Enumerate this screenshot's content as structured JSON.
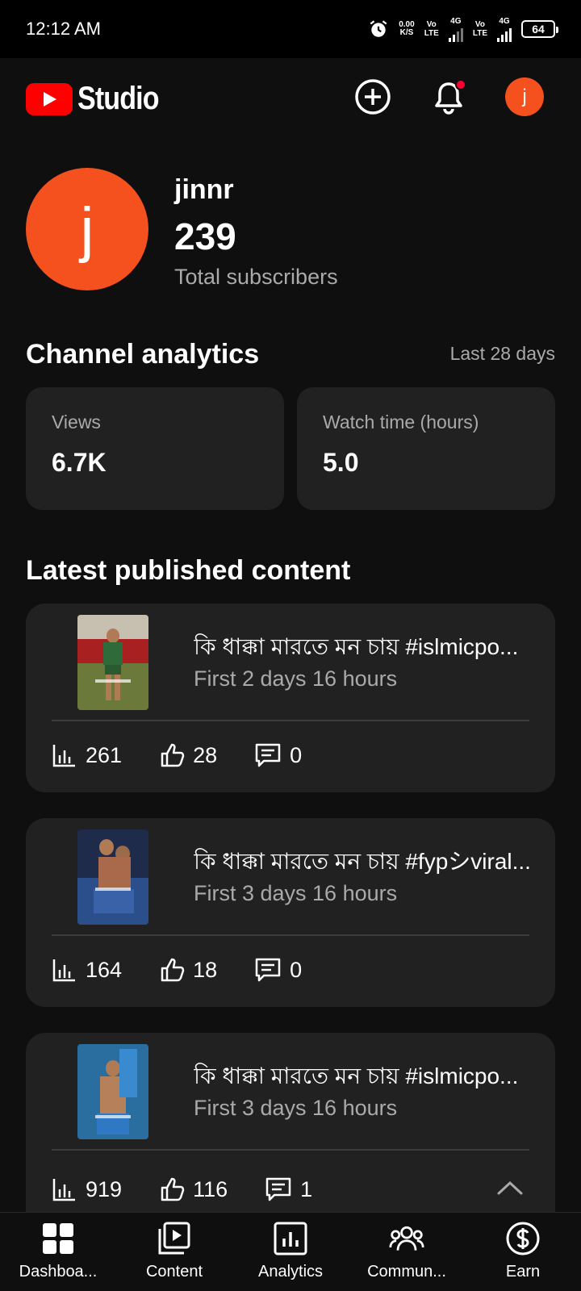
{
  "status_bar": {
    "time": "12:12 AM",
    "net_speed_value": "0.00",
    "net_speed_unit": "K/S",
    "sim1_top": "Vo",
    "sim1_bottom": "LTE",
    "sim1_type": "4G",
    "sim2_top": "Vo",
    "sim2_bottom": "LTE",
    "sim2_type": "4G",
    "battery": "64"
  },
  "header": {
    "logo_text": "Studio",
    "avatar_letter": "j",
    "icons": [
      "create-icon",
      "bell-icon"
    ]
  },
  "channel": {
    "avatar_letter": "j",
    "name": "jinnr",
    "subscriber_count": "239",
    "subscriber_label": "Total subscribers"
  },
  "analytics": {
    "title": "Channel analytics",
    "period": "Last 28 days",
    "cards": [
      {
        "label": "Views",
        "value": "6.7K"
      },
      {
        "label": "Watch time (hours)",
        "value": "5.0"
      }
    ]
  },
  "latest": {
    "title": "Latest published content",
    "videos": [
      {
        "title": "কি ধাক্কা মারতে মন চায় #islmicpo...",
        "age": "First 2 days 16 hours",
        "views": "261",
        "likes": "28",
        "comments": "0"
      },
      {
        "title": "কি ধাক্কা মারতে মন চায় #fypシviral...",
        "age": "First 3 days 16 hours",
        "views": "164",
        "likes": "18",
        "comments": "0"
      },
      {
        "title": "কি ধাক্কা মারতে মন চায় #islmicpo...",
        "age": "First 3 days 16 hours",
        "views": "919",
        "likes": "116",
        "comments": "1"
      }
    ]
  },
  "nav": {
    "items": [
      {
        "label": "Dashboa...",
        "icon": "dashboard-icon"
      },
      {
        "label": "Content",
        "icon": "content-icon"
      },
      {
        "label": "Analytics",
        "icon": "analytics-icon"
      },
      {
        "label": "Commun...",
        "icon": "community-icon"
      },
      {
        "label": "Earn",
        "icon": "earn-icon"
      }
    ]
  },
  "colors": {
    "background": "#0f0f0f",
    "card": "#212121",
    "accent_red": "#ff0000",
    "avatar_orange": "#f4511e",
    "secondary_text": "#aaaaaa"
  }
}
